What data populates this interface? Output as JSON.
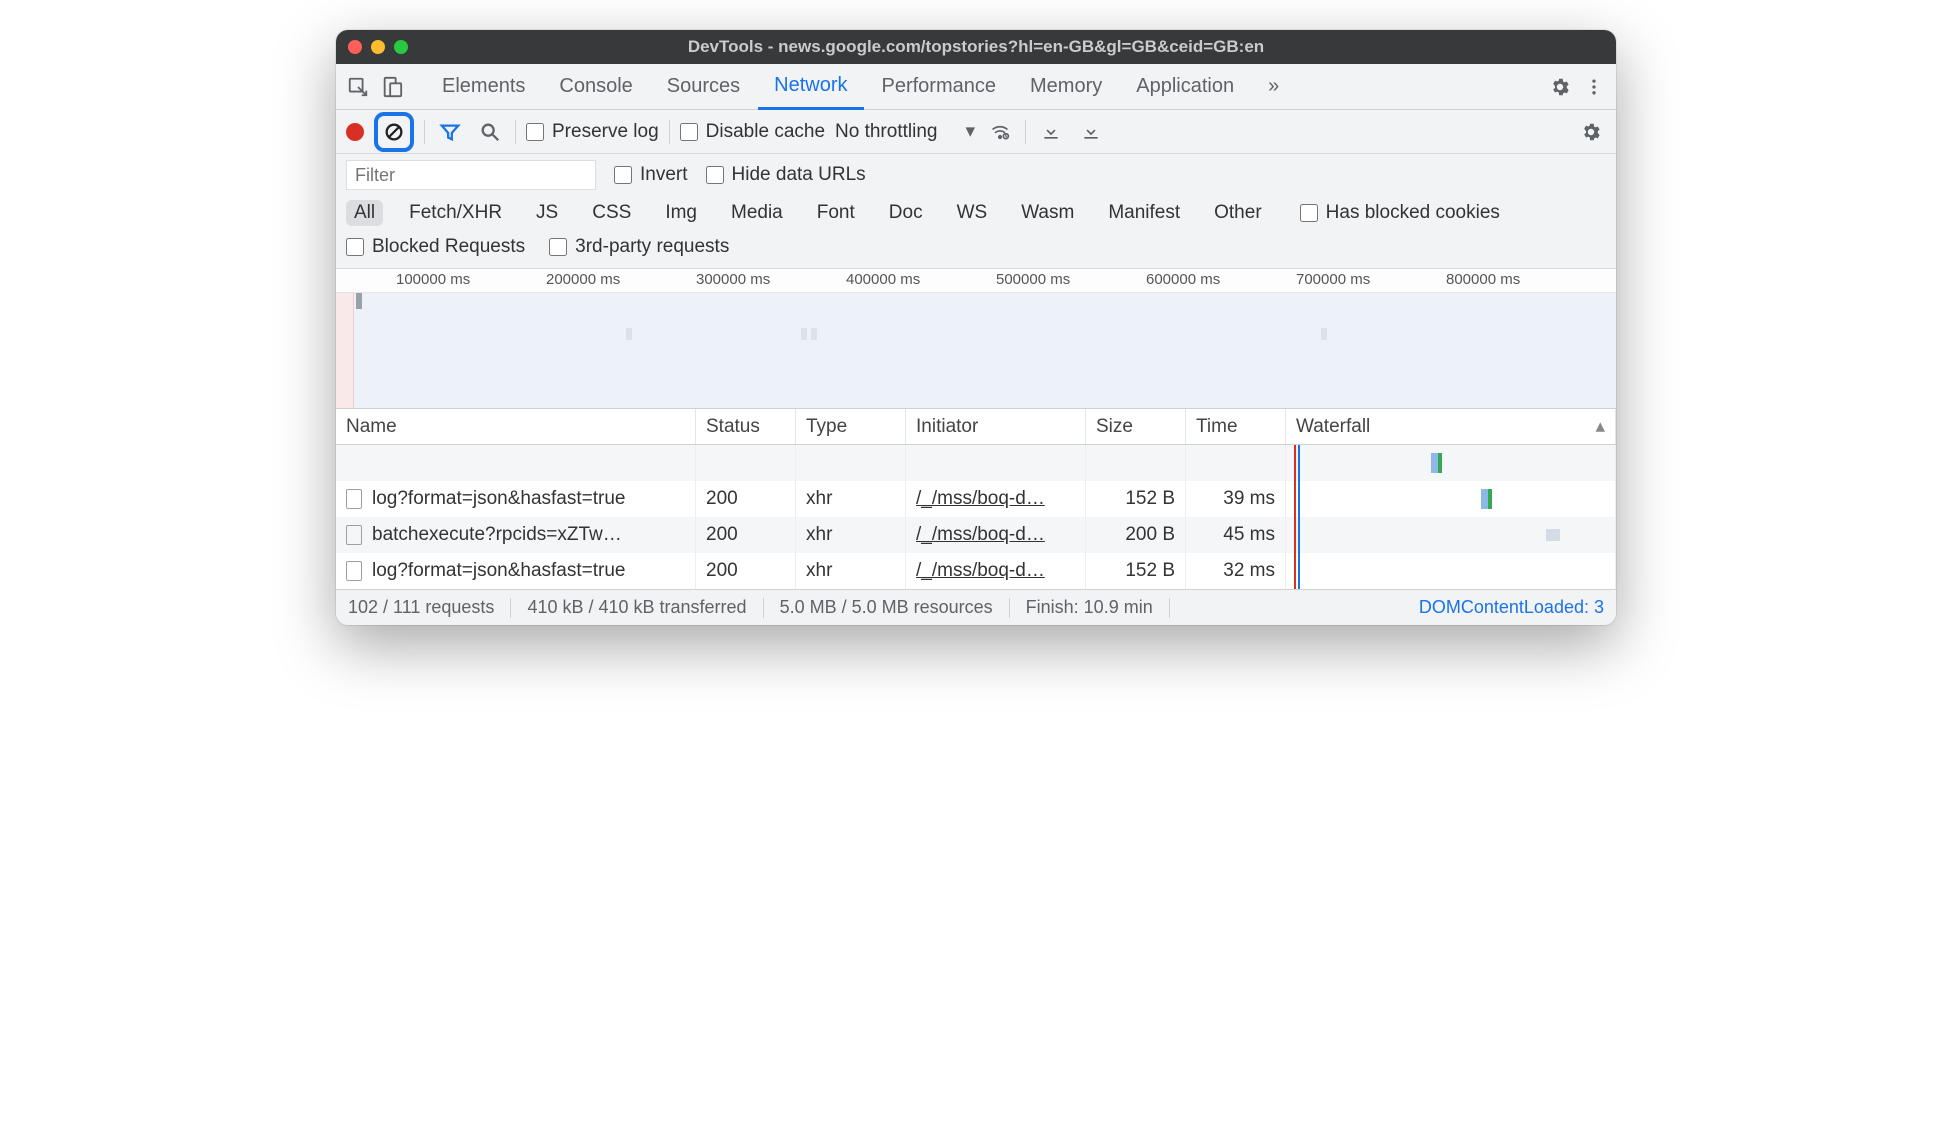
{
  "window": {
    "title": "DevTools - news.google.com/topstories?hl=en-GB&gl=GB&ceid=GB:en"
  },
  "tabs": {
    "items": [
      "Elements",
      "Console",
      "Sources",
      "Network",
      "Performance",
      "Memory",
      "Application"
    ],
    "active": "Network",
    "more": "»"
  },
  "toolbar": {
    "preserve_log": "Preserve log",
    "disable_cache": "Disable cache",
    "throttling": "No throttling"
  },
  "filter": {
    "placeholder": "Filter",
    "invert": "Invert",
    "hide_data_urls": "Hide data URLs",
    "types": [
      "All",
      "Fetch/XHR",
      "JS",
      "CSS",
      "Img",
      "Media",
      "Font",
      "Doc",
      "WS",
      "Wasm",
      "Manifest",
      "Other"
    ],
    "active_type": "All",
    "has_blocked_cookies": "Has blocked cookies",
    "blocked_requests": "Blocked Requests",
    "third_party": "3rd-party requests"
  },
  "timeline": {
    "ticks": [
      "100000 ms",
      "200000 ms",
      "300000 ms",
      "400000 ms",
      "500000 ms",
      "600000 ms",
      "700000 ms",
      "800000 ms"
    ]
  },
  "table": {
    "headers": {
      "name": "Name",
      "status": "Status",
      "type": "Type",
      "initiator": "Initiator",
      "size": "Size",
      "time": "Time",
      "waterfall": "Waterfall"
    },
    "rows": [
      {
        "name": "log?format=json&hasfast=true",
        "status": "200",
        "type": "xhr",
        "initiator": "/_/mss/boq-d…",
        "size": "152 B",
        "time": "39 ms"
      },
      {
        "name": "batchexecute?rpcids=xZTw…",
        "status": "200",
        "type": "xhr",
        "initiator": "/_/mss/boq-d…",
        "size": "200 B",
        "time": "45 ms"
      },
      {
        "name": "log?format=json&hasfast=true",
        "status": "200",
        "type": "xhr",
        "initiator": "/_/mss/boq-d…",
        "size": "152 B",
        "time": "32 ms"
      }
    ]
  },
  "status": {
    "requests": "102 / 111 requests",
    "transferred": "410 kB / 410 kB transferred",
    "resources": "5.0 MB / 5.0 MB resources",
    "finish": "Finish: 10.9 min",
    "domcontentloaded": "DOMContentLoaded: 3"
  }
}
